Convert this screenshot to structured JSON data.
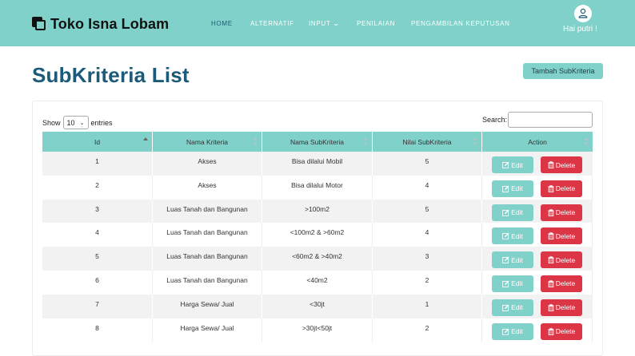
{
  "navbar": {
    "brand": "Toko Isna Lobam",
    "items": [
      {
        "label": "HOME",
        "active": true
      },
      {
        "label": "ALTERNATIF"
      },
      {
        "label": "INPUT"
      },
      {
        "label": "PENILAIAN"
      },
      {
        "label": "PENGAMBILAN KEPUTUSAN"
      }
    ],
    "greeting": "Hai putri !"
  },
  "page": {
    "title": "SubKriteria List",
    "add_button": "Tambah SubKriteria"
  },
  "table_controls": {
    "show": "Show",
    "entries_value": "10",
    "entries": "entries",
    "search_label": "Search:",
    "search_value": ""
  },
  "table": {
    "columns": [
      "Id",
      "Nama Kriteria",
      "Nama SubKriteria",
      "Nilai SubKriteria",
      "Action"
    ],
    "sorted_column": "Id",
    "sort_direction": "ascending",
    "edit_label": "Edit",
    "delete_label": "Delete",
    "rows": [
      {
        "id": "1",
        "kriteria": "Akses",
        "sub": "Bisa dilalui Mobil",
        "nilai": "5"
      },
      {
        "id": "2",
        "kriteria": "Akses",
        "sub": "Bisa dilalui Motor",
        "nilai": "4"
      },
      {
        "id": "3",
        "kriteria": "Luas Tanah dan Bangunan",
        "sub": ">100m2",
        "nilai": "5"
      },
      {
        "id": "4",
        "kriteria": "Luas Tanah dan Bangunan",
        "sub": "<100m2 & >60m2",
        "nilai": "4"
      },
      {
        "id": "5",
        "kriteria": "Luas Tanah dan Bangunan",
        "sub": "<60m2 & >40m2",
        "nilai": "3"
      },
      {
        "id": "6",
        "kriteria": "Luas Tanah dan Bangunan",
        "sub": "<40m2",
        "nilai": "2"
      },
      {
        "id": "7",
        "kriteria": "Harga Sewa/ Jual",
        "sub": "<30jt",
        "nilai": "1"
      },
      {
        "id": "8",
        "kriteria": "Harga Sewa/ Jual",
        "sub": ">30jt<50jt",
        "nilai": "2"
      }
    ]
  },
  "colors": {
    "accent": "#7fd1c9",
    "title": "#1b5a78",
    "active_nav": "#1a5a73",
    "danger": "#dc3545"
  },
  "icons": {
    "brand": "squares-icon",
    "user": "user-icon",
    "edit": "edit-icon",
    "delete": "trash-icon"
  }
}
